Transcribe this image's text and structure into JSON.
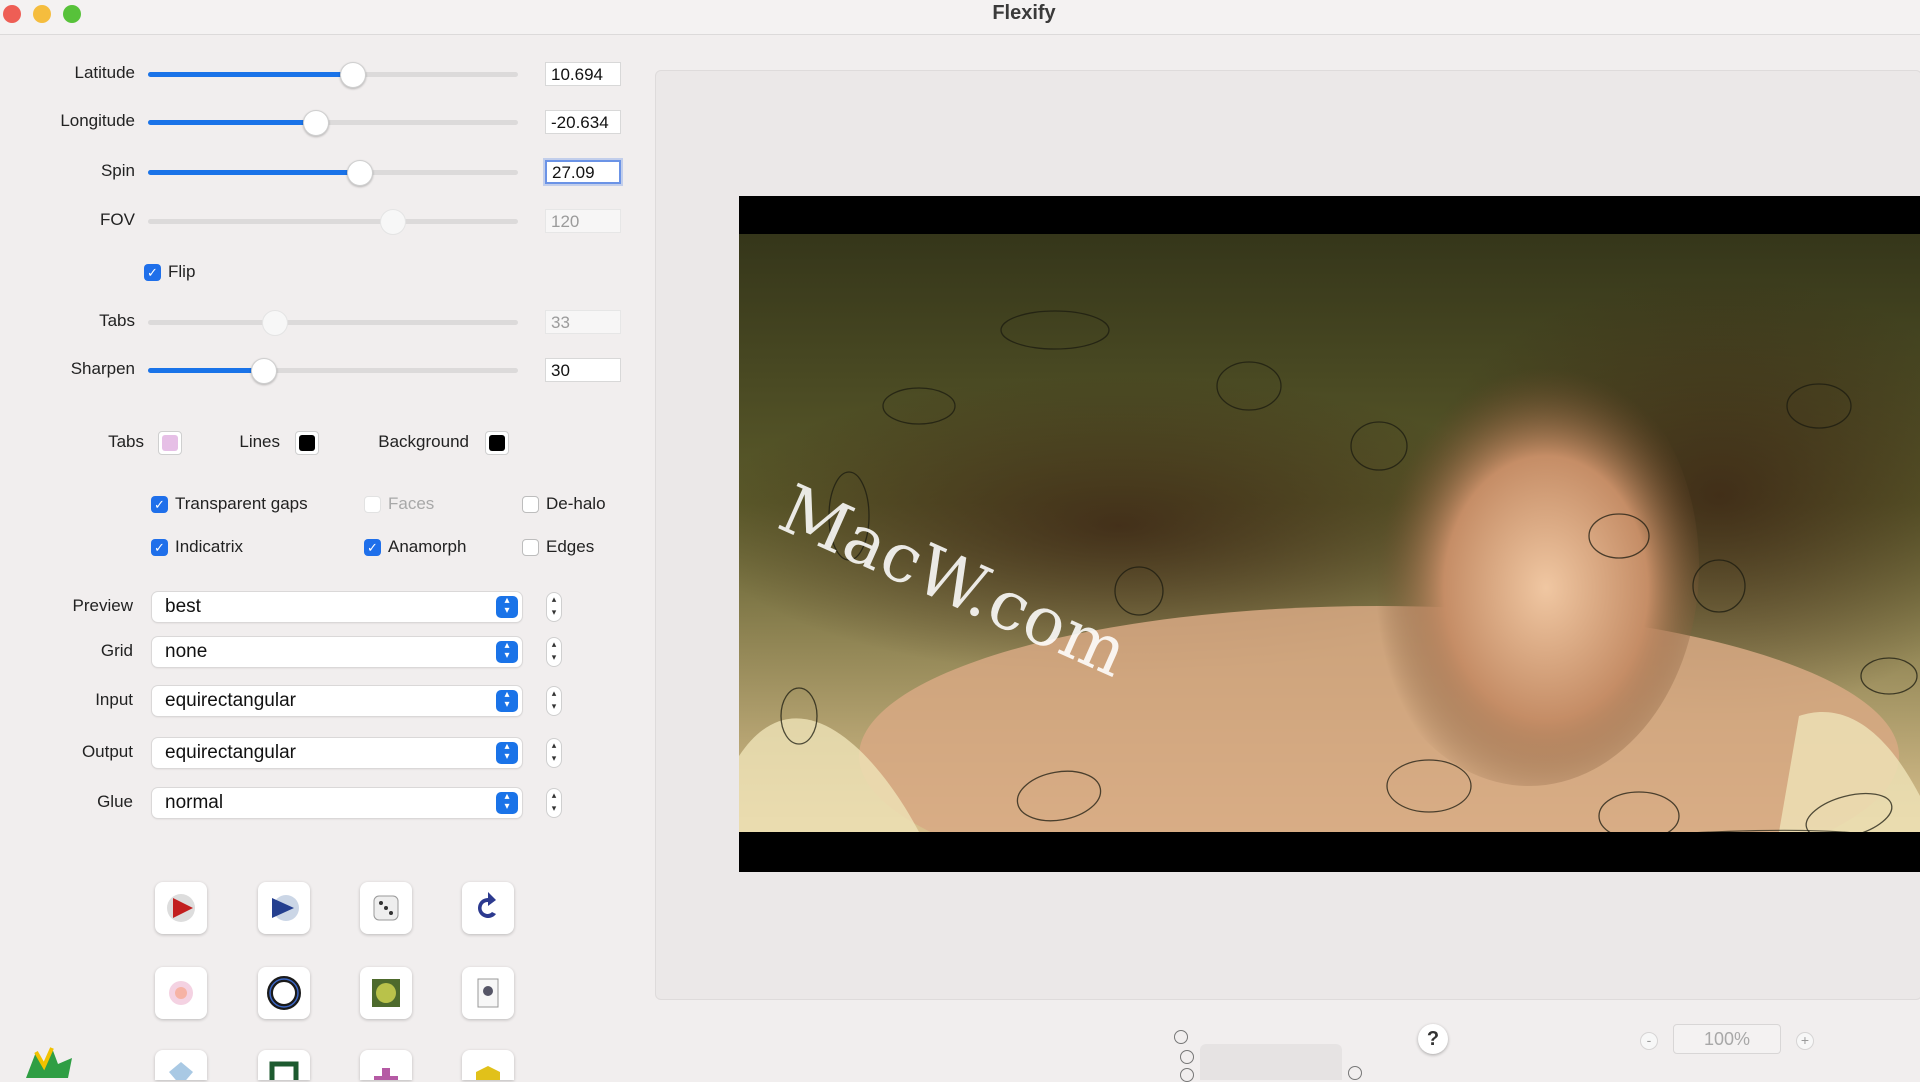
{
  "window": {
    "title": "Flexify"
  },
  "sliders": [
    {
      "label": "Latitude",
      "value": "10.694",
      "fraction": 0.55,
      "enabled": true,
      "focused": false
    },
    {
      "label": "Longitude",
      "value": "-20.634",
      "fraction": 0.45,
      "enabled": true,
      "focused": false
    },
    {
      "label": "Spin",
      "value": "27.09",
      "fraction": 0.57,
      "enabled": true,
      "focused": true
    },
    {
      "label": "FOV",
      "value": "120",
      "fraction": 0.66,
      "enabled": false,
      "focused": false
    },
    {
      "label": "Tabs",
      "value": "33",
      "fraction": 0.34,
      "enabled": false,
      "focused": false
    },
    {
      "label": "Sharpen",
      "value": "30",
      "fraction": 0.31,
      "enabled": true,
      "focused": false
    }
  ],
  "flip": {
    "label": "Flip",
    "checked": true
  },
  "colors": [
    {
      "label": "Tabs",
      "color": "#e6bfe6"
    },
    {
      "label": "Lines",
      "color": "#000000"
    },
    {
      "label": "Background",
      "color": "#000000"
    }
  ],
  "options": [
    {
      "label": "Transparent gaps",
      "checked": true,
      "enabled": true
    },
    {
      "label": "Faces",
      "checked": false,
      "enabled": false
    },
    {
      "label": "De-halo",
      "checked": false,
      "enabled": true
    },
    {
      "label": "Indicatrix",
      "checked": true,
      "enabled": true
    },
    {
      "label": "Anamorph",
      "checked": true,
      "enabled": true
    },
    {
      "label": "Edges",
      "checked": false,
      "enabled": true
    }
  ],
  "selects": [
    {
      "label": "Preview",
      "value": "best"
    },
    {
      "label": "Grid",
      "value": "none"
    },
    {
      "label": "Input",
      "value": "equirectangular"
    },
    {
      "label": "Output",
      "value": "equirectangular"
    },
    {
      "label": "Glue",
      "value": "normal"
    }
  ],
  "tools": [
    {
      "name": "render-icon"
    },
    {
      "name": "play-icon"
    },
    {
      "name": "dice-icon"
    },
    {
      "name": "undo-icon"
    },
    {
      "name": "flower-icon"
    },
    {
      "name": "ring-icon"
    },
    {
      "name": "globe-icon"
    },
    {
      "name": "file-icon"
    },
    {
      "name": "gem-icon"
    },
    {
      "name": "frame-icon"
    },
    {
      "name": "blocks-icon"
    },
    {
      "name": "cube-icon"
    }
  ],
  "preview": {
    "watermark": "MacW.com",
    "zoom": "100%",
    "zoom_minus": "-",
    "zoom_plus": "+",
    "help": "?"
  },
  "theme": {
    "accent": "#1a73e8",
    "close": "#ee5e55",
    "minimize": "#f5bd3e",
    "zoom": "#57c23a"
  }
}
